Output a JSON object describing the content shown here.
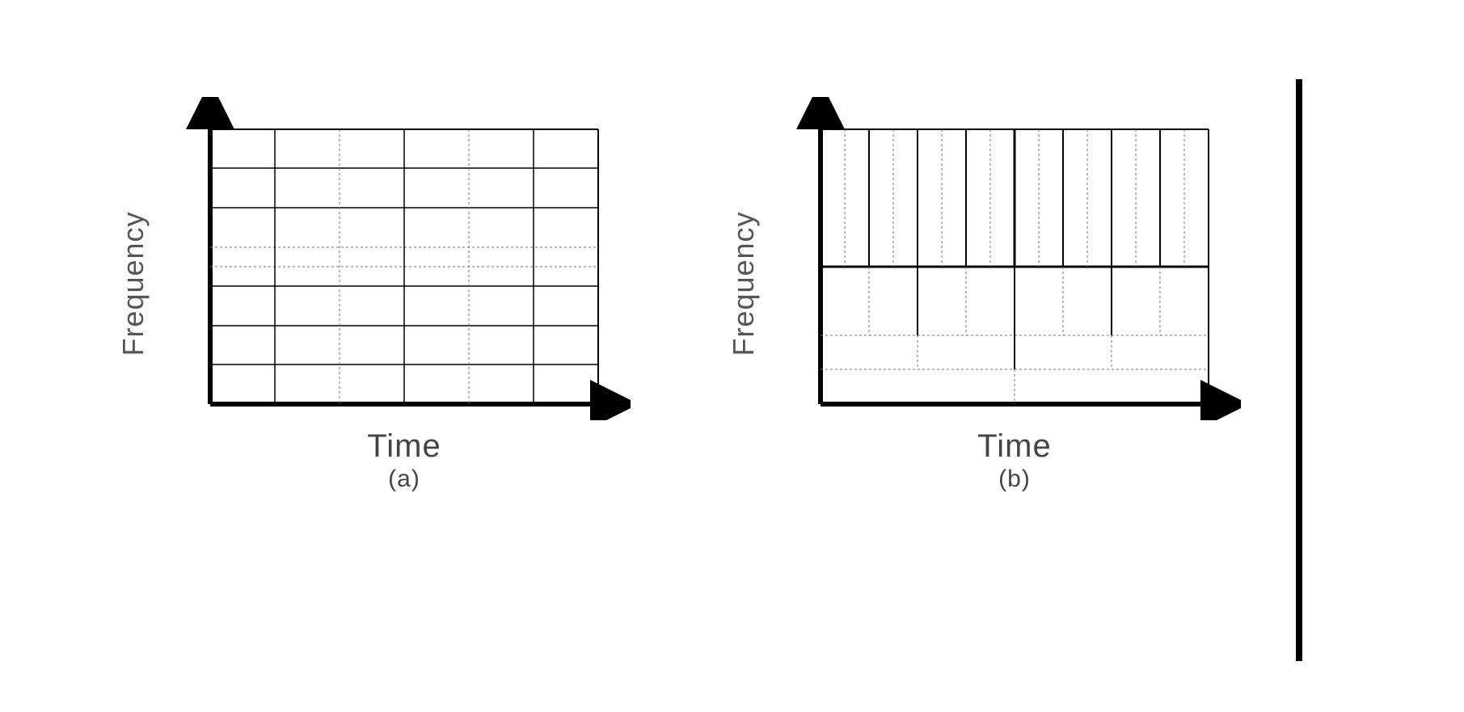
{
  "panels": {
    "a": {
      "ylabel": "Frequency",
      "xlabel": "Time",
      "sublabel": "(a)"
    },
    "b": {
      "ylabel": "Frequency",
      "xlabel": "Time",
      "sublabel": "(b)"
    }
  },
  "chart_data": [
    {
      "type": "diagram",
      "description": "Uniform time-frequency tiling (STFT-like)",
      "xlabel": "Time",
      "ylabel": "Frequency",
      "sublabel": "(a)",
      "grid": {
        "time_divisions": [
          0,
          0.167,
          0.333,
          0.5,
          0.667,
          0.833,
          1.0
        ],
        "freq_divisions": [
          0,
          0.143,
          0.286,
          0.429,
          0.571,
          0.714,
          0.857,
          1.0
        ]
      }
    },
    {
      "type": "diagram",
      "description": "Dyadic (wavelet-like) time-frequency tiling: coarse time / fine frequency at low frequency, fine time / coarse frequency at high frequency",
      "xlabel": "Time",
      "ylabel": "Frequency",
      "sublabel": "(b)",
      "tiling": {
        "high_freq_band": {
          "freq_range": [
            0.5,
            1.0
          ],
          "time_divisions": 16
        },
        "mid_freq_band": {
          "freq_range": [
            0.25,
            0.5
          ],
          "time_divisions": 8
        },
        "low_freq_band": {
          "freq_range": [
            0.125,
            0.25
          ],
          "time_divisions": 4
        },
        "lowest_freq_band": {
          "freq_range": [
            0.0,
            0.125
          ],
          "time_divisions": 2
        }
      }
    }
  ]
}
